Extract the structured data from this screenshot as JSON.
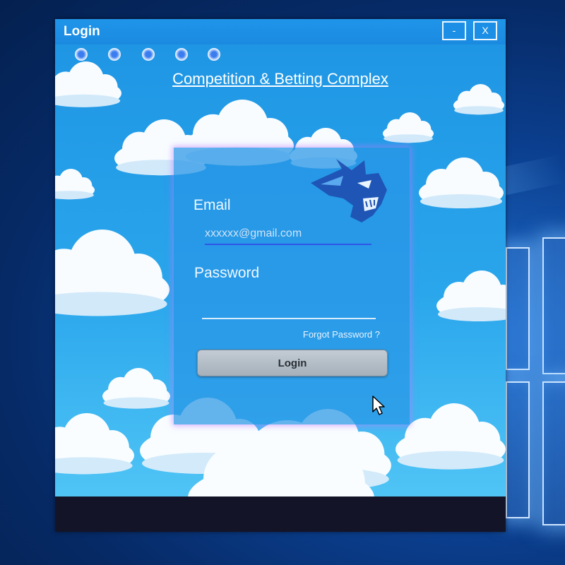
{
  "window": {
    "title": "Login",
    "minimize_label": "-",
    "close_label": "X"
  },
  "header": {
    "complex_title": "Competition & Betting Complex"
  },
  "login_form": {
    "email_label": "Email",
    "email_placeholder": "xxxxxx@gmail.com",
    "email_value": "",
    "password_label": "Password",
    "password_value": "",
    "forgot_password_label": "Forgot Password ?",
    "login_button_label": "Login"
  },
  "icons": {
    "logo": "wildcat-logo-icon",
    "indicator_dots": "indicator-dot-icon",
    "cursor": "mouse-pointer-icon"
  },
  "colors": {
    "titlebar": "#1a8ae0",
    "sky": "#2aa6ec",
    "card": "#2896e6",
    "email_underline": "#2f56e8",
    "button": "#b4bec8",
    "bottom_bar": "#141428"
  }
}
